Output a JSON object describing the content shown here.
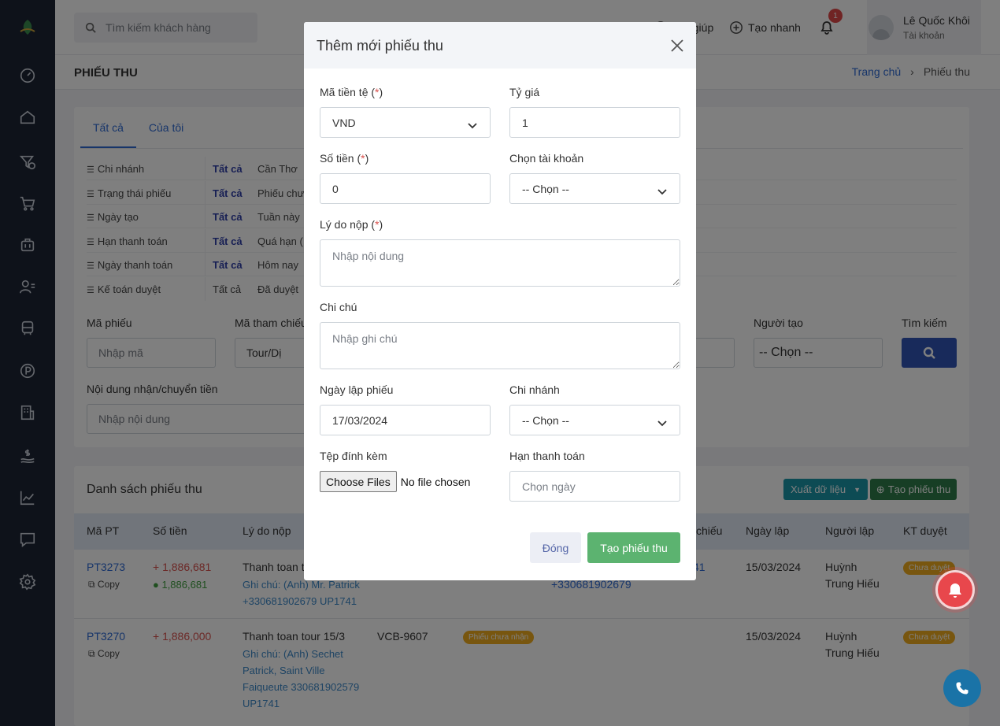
{
  "header": {
    "search_placeholder": "Tìm kiếm khách hàng",
    "help_label": "Trợ giúp",
    "quick_create_label": "Tạo nhanh",
    "notification_count": "1",
    "user_name": "Lê Quốc Khôi",
    "user_sub": "Tài khoản"
  },
  "page": {
    "title": "PHIẾU THU",
    "breadcrumb_home": "Trang chủ",
    "breadcrumb_sep": "›",
    "breadcrumb_current": "Phiếu thu"
  },
  "filters": {
    "tabs": [
      "Tất cả",
      "Của tôi"
    ],
    "rows": [
      {
        "label": "Chi nhánh",
        "all": "Tất cả",
        "option": "Cần Thơ"
      },
      {
        "label": "Trạng thái phiếu",
        "all": "Tất cả",
        "option": "Phiếu chư"
      },
      {
        "label": "Ngày tạo",
        "all": "Tất cả",
        "option": "Tuần này"
      },
      {
        "label": "Hạn thanh toán",
        "all": "Tất cả",
        "option": "Quá hạn ("
      },
      {
        "label": "Ngày thanh toán",
        "all": "Tất cả",
        "option": "Hôm nay"
      },
      {
        "label": "Kế toán duyệt",
        "all": "Tất cả",
        "option": "Đã duyệt"
      }
    ],
    "ma_phieu_label": "Mã phiếu",
    "ma_phieu_placeholder": "Nhập mã",
    "ma_tham_chieu_label": "Mã tham chiếu",
    "ma_tham_chieu_value": "Tour/Dị",
    "nguoi_tao_label": "Người tạo",
    "nguoi_tao_value": "-- Chọn --",
    "tim_kiem_label": "Tìm kiếm",
    "noi_dung_label": "Nội dung nhận/chuyển tiền",
    "noi_dung_placeholder": "Nhập nội dung"
  },
  "list": {
    "title": "Danh sách phiếu thu",
    "export_label": "Xuất dữ liệu",
    "create_label": "Tạo phiếu thu",
    "columns": [
      "Mã PT",
      "Số tiền",
      "Lý do nộp",
      "chiếu",
      "Ngày lập",
      "Người lập",
      "KT duyệt"
    ],
    "rows": [
      {
        "code": "PT3273",
        "copy": "Copy",
        "amount": "+ 1,886,681",
        "amount_paid": "1,886,681",
        "reason": "Thanh toan t",
        "note_lines": [
          "Ghi chú: (Anh) Mr. Patrick",
          "+330681902679 UP1741"
        ],
        "ref_fragment": "41",
        "ref_phone": "+330681902679",
        "date": "15/03/2024",
        "creator_lines": [
          "Huỳnh",
          "Trung Hiếu"
        ],
        "kt_status": "Chưa duyệt"
      },
      {
        "code": "PT3270",
        "copy": "Copy",
        "amount": "+ 1,886,000",
        "reason": "Thanh toan tour 15/3",
        "note_lines": [
          "Ghi chú: (Anh) Sechet",
          "Patrick, Saint Ville",
          "Faiqueute 330681902579",
          "UP1741"
        ],
        "account": "VCB-9607",
        "status": "Phiếu chưa nhận",
        "date": "15/03/2024",
        "creator_lines": [
          "Huỳnh",
          "Trung Hiếu"
        ],
        "kt_status": "Chưa duyệt"
      }
    ]
  },
  "modal": {
    "title": "Thêm mới phiếu thu",
    "currency_label": "Mã tiền tệ (",
    "req": "*",
    "close_paren": ")",
    "currency_value": "VND",
    "rate_label": "Tỷ giá",
    "rate_value": "1",
    "amount_label": "Số tiền (",
    "amount_value": "0",
    "account_label": "Chọn tài khoản",
    "account_value": "-- Chọn --",
    "reason_label": "Lý do nộp (",
    "reason_placeholder": "Nhập nội dung",
    "note_label": "Chi chú",
    "note_placeholder": "Nhập ghi chú",
    "date_label": "Ngày lập phiếu",
    "date_value": "17/03/2024",
    "branch_label": "Chi nhánh",
    "branch_value": "-- Chọn --",
    "file_label": "Tệp đính kèm",
    "file_button": "Choose Files",
    "file_status": "No file chosen",
    "due_label": "Hạn thanh toán",
    "due_placeholder": "Chọn ngày",
    "close_button": "Đóng",
    "submit_button": "Tạo phiếu thu"
  }
}
